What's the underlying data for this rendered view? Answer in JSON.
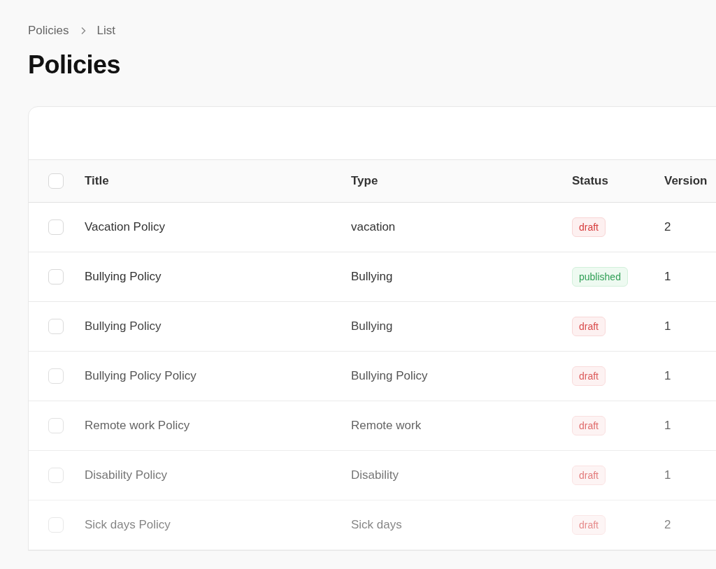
{
  "breadcrumb": [
    "Policies",
    "List"
  ],
  "title": "Policies",
  "table": {
    "columns": [
      "Title",
      "Type",
      "Status",
      "Version"
    ],
    "select_all": {
      "checked": false
    },
    "rows": [
      {
        "checked": false,
        "title": "Vacation Policy",
        "type": "vacation",
        "status": {
          "text": "draft",
          "kind": "draft"
        },
        "version": "2"
      },
      {
        "checked": false,
        "title": "Bullying Policy",
        "type": "Bullying",
        "status": {
          "text": "published",
          "kind": "published"
        },
        "version": "1"
      },
      {
        "checked": false,
        "title": "Bullying Policy",
        "type": "Bullying",
        "status": {
          "text": "draft",
          "kind": "draft"
        },
        "version": "1"
      },
      {
        "checked": false,
        "title": "Bullying Policy Policy",
        "type": "Bullying Policy",
        "status": {
          "text": "draft",
          "kind": "draft"
        },
        "version": "1"
      },
      {
        "checked": false,
        "title": "Remote work Policy",
        "type": "Remote work",
        "status": {
          "text": "draft",
          "kind": "draft"
        },
        "version": "1"
      },
      {
        "checked": false,
        "title": "Disability Policy",
        "type": "Disability",
        "status": {
          "text": "draft",
          "kind": "draft"
        },
        "version": "1"
      },
      {
        "checked": false,
        "title": "Sick days Policy",
        "type": "Sick days",
        "status": {
          "text": "draft",
          "kind": "draft"
        },
        "version": "2"
      }
    ]
  }
}
